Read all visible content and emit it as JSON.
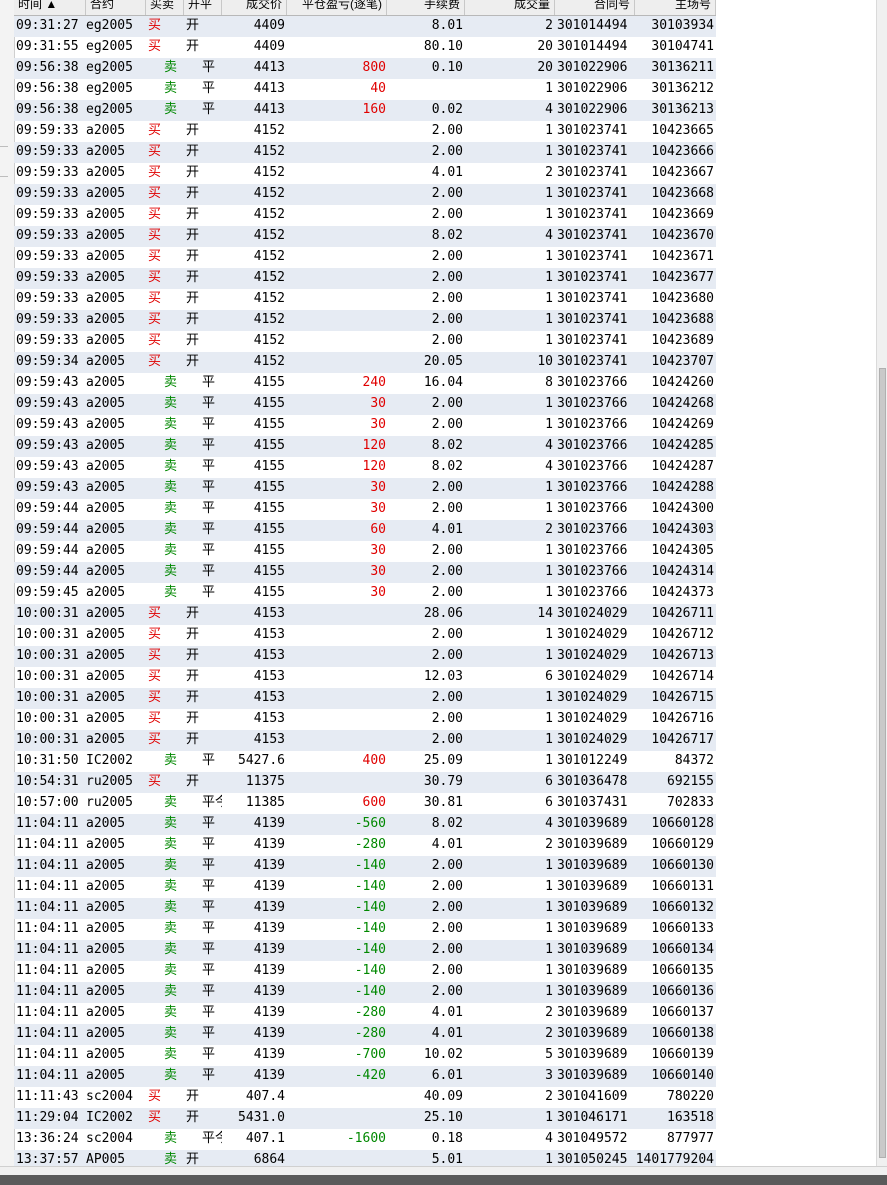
{
  "columns": {
    "time": "时间 ▲",
    "symbol": "合约",
    "direction": "买卖",
    "open_close": "开平",
    "price": "成交价",
    "close_pnl": "平仓盈亏(逐笔)",
    "fee": "手续费",
    "qty": "成交量",
    "order_no": "合同号",
    "trade_no": "主场号"
  },
  "rows": [
    [
      "09:31:27",
      "eg2005",
      "买",
      "开",
      "4409",
      "",
      "8.01",
      "2",
      "301014494",
      "30103934"
    ],
    [
      "09:31:55",
      "eg2005",
      "买",
      "开",
      "4409",
      "",
      "80.10",
      "20",
      "301014494",
      "30104741"
    ],
    [
      "09:56:38",
      "eg2005",
      "卖",
      "平",
      "4413",
      "800",
      "0.10",
      "20",
      "301022906",
      "30136211"
    ],
    [
      "09:56:38",
      "eg2005",
      "卖",
      "平",
      "4413",
      "40",
      "",
      "1",
      "301022906",
      "30136212"
    ],
    [
      "09:56:38",
      "eg2005",
      "卖",
      "平",
      "4413",
      "160",
      "0.02",
      "4",
      "301022906",
      "30136213"
    ],
    [
      "09:59:33",
      "a2005",
      "买",
      "开",
      "4152",
      "",
      "2.00",
      "1",
      "301023741",
      "10423665"
    ],
    [
      "09:59:33",
      "a2005",
      "买",
      "开",
      "4152",
      "",
      "2.00",
      "1",
      "301023741",
      "10423666"
    ],
    [
      "09:59:33",
      "a2005",
      "买",
      "开",
      "4152",
      "",
      "4.01",
      "2",
      "301023741",
      "10423667"
    ],
    [
      "09:59:33",
      "a2005",
      "买",
      "开",
      "4152",
      "",
      "2.00",
      "1",
      "301023741",
      "10423668"
    ],
    [
      "09:59:33",
      "a2005",
      "买",
      "开",
      "4152",
      "",
      "2.00",
      "1",
      "301023741",
      "10423669"
    ],
    [
      "09:59:33",
      "a2005",
      "买",
      "开",
      "4152",
      "",
      "8.02",
      "4",
      "301023741",
      "10423670"
    ],
    [
      "09:59:33",
      "a2005",
      "买",
      "开",
      "4152",
      "",
      "2.00",
      "1",
      "301023741",
      "10423671"
    ],
    [
      "09:59:33",
      "a2005",
      "买",
      "开",
      "4152",
      "",
      "2.00",
      "1",
      "301023741",
      "10423677"
    ],
    [
      "09:59:33",
      "a2005",
      "买",
      "开",
      "4152",
      "",
      "2.00",
      "1",
      "301023741",
      "10423680"
    ],
    [
      "09:59:33",
      "a2005",
      "买",
      "开",
      "4152",
      "",
      "2.00",
      "1",
      "301023741",
      "10423688"
    ],
    [
      "09:59:33",
      "a2005",
      "买",
      "开",
      "4152",
      "",
      "2.00",
      "1",
      "301023741",
      "10423689"
    ],
    [
      "09:59:34",
      "a2005",
      "买",
      "开",
      "4152",
      "",
      "20.05",
      "10",
      "301023741",
      "10423707"
    ],
    [
      "09:59:43",
      "a2005",
      "卖",
      "平",
      "4155",
      "240",
      "16.04",
      "8",
      "301023766",
      "10424260"
    ],
    [
      "09:59:43",
      "a2005",
      "卖",
      "平",
      "4155",
      "30",
      "2.00",
      "1",
      "301023766",
      "10424268"
    ],
    [
      "09:59:43",
      "a2005",
      "卖",
      "平",
      "4155",
      "30",
      "2.00",
      "1",
      "301023766",
      "10424269"
    ],
    [
      "09:59:43",
      "a2005",
      "卖",
      "平",
      "4155",
      "120",
      "8.02",
      "4",
      "301023766",
      "10424285"
    ],
    [
      "09:59:43",
      "a2005",
      "卖",
      "平",
      "4155",
      "120",
      "8.02",
      "4",
      "301023766",
      "10424287"
    ],
    [
      "09:59:43",
      "a2005",
      "卖",
      "平",
      "4155",
      "30",
      "2.00",
      "1",
      "301023766",
      "10424288"
    ],
    [
      "09:59:44",
      "a2005",
      "卖",
      "平",
      "4155",
      "30",
      "2.00",
      "1",
      "301023766",
      "10424300"
    ],
    [
      "09:59:44",
      "a2005",
      "卖",
      "平",
      "4155",
      "60",
      "4.01",
      "2",
      "301023766",
      "10424303"
    ],
    [
      "09:59:44",
      "a2005",
      "卖",
      "平",
      "4155",
      "30",
      "2.00",
      "1",
      "301023766",
      "10424305"
    ],
    [
      "09:59:44",
      "a2005",
      "卖",
      "平",
      "4155",
      "30",
      "2.00",
      "1",
      "301023766",
      "10424314"
    ],
    [
      "09:59:45",
      "a2005",
      "卖",
      "平",
      "4155",
      "30",
      "2.00",
      "1",
      "301023766",
      "10424373"
    ],
    [
      "10:00:31",
      "a2005",
      "买",
      "开",
      "4153",
      "",
      "28.06",
      "14",
      "301024029",
      "10426711"
    ],
    [
      "10:00:31",
      "a2005",
      "买",
      "开",
      "4153",
      "",
      "2.00",
      "1",
      "301024029",
      "10426712"
    ],
    [
      "10:00:31",
      "a2005",
      "买",
      "开",
      "4153",
      "",
      "2.00",
      "1",
      "301024029",
      "10426713"
    ],
    [
      "10:00:31",
      "a2005",
      "买",
      "开",
      "4153",
      "",
      "12.03",
      "6",
      "301024029",
      "10426714"
    ],
    [
      "10:00:31",
      "a2005",
      "买",
      "开",
      "4153",
      "",
      "2.00",
      "1",
      "301024029",
      "10426715"
    ],
    [
      "10:00:31",
      "a2005",
      "买",
      "开",
      "4153",
      "",
      "2.00",
      "1",
      "301024029",
      "10426716"
    ],
    [
      "10:00:31",
      "a2005",
      "买",
      "开",
      "4153",
      "",
      "2.00",
      "1",
      "301024029",
      "10426717"
    ],
    [
      "10:31:50",
      "IC2002",
      "卖",
      "平",
      "5427.6",
      "400",
      "25.09",
      "1",
      "301012249",
      "84372"
    ],
    [
      "10:54:31",
      "ru2005",
      "买",
      "开",
      "11375",
      "",
      "30.79",
      "6",
      "301036478",
      "692155"
    ],
    [
      "10:57:00",
      "ru2005",
      "卖",
      "平今",
      "11385",
      "600",
      "30.81",
      "6",
      "301037431",
      "702833"
    ],
    [
      "11:04:11",
      "a2005",
      "卖",
      "平",
      "4139",
      "-560",
      "8.02",
      "4",
      "301039689",
      "10660128"
    ],
    [
      "11:04:11",
      "a2005",
      "卖",
      "平",
      "4139",
      "-280",
      "4.01",
      "2",
      "301039689",
      "10660129"
    ],
    [
      "11:04:11",
      "a2005",
      "卖",
      "平",
      "4139",
      "-140",
      "2.00",
      "1",
      "301039689",
      "10660130"
    ],
    [
      "11:04:11",
      "a2005",
      "卖",
      "平",
      "4139",
      "-140",
      "2.00",
      "1",
      "301039689",
      "10660131"
    ],
    [
      "11:04:11",
      "a2005",
      "卖",
      "平",
      "4139",
      "-140",
      "2.00",
      "1",
      "301039689",
      "10660132"
    ],
    [
      "11:04:11",
      "a2005",
      "卖",
      "平",
      "4139",
      "-140",
      "2.00",
      "1",
      "301039689",
      "10660133"
    ],
    [
      "11:04:11",
      "a2005",
      "卖",
      "平",
      "4139",
      "-140",
      "2.00",
      "1",
      "301039689",
      "10660134"
    ],
    [
      "11:04:11",
      "a2005",
      "卖",
      "平",
      "4139",
      "-140",
      "2.00",
      "1",
      "301039689",
      "10660135"
    ],
    [
      "11:04:11",
      "a2005",
      "卖",
      "平",
      "4139",
      "-140",
      "2.00",
      "1",
      "301039689",
      "10660136"
    ],
    [
      "11:04:11",
      "a2005",
      "卖",
      "平",
      "4139",
      "-280",
      "4.01",
      "2",
      "301039689",
      "10660137"
    ],
    [
      "11:04:11",
      "a2005",
      "卖",
      "平",
      "4139",
      "-280",
      "4.01",
      "2",
      "301039689",
      "10660138"
    ],
    [
      "11:04:11",
      "a2005",
      "卖",
      "平",
      "4139",
      "-700",
      "10.02",
      "5",
      "301039689",
      "10660139"
    ],
    [
      "11:04:11",
      "a2005",
      "卖",
      "平",
      "4139",
      "-420",
      "6.01",
      "3",
      "301039689",
      "10660140"
    ],
    [
      "11:11:43",
      "sc2004",
      "买",
      "开",
      "407.4",
      "",
      "40.09",
      "2",
      "301041609",
      "780220"
    ],
    [
      "11:29:04",
      "IC2002",
      "买",
      "开",
      "5431.0",
      "",
      "25.10",
      "1",
      "301046171",
      "163518"
    ],
    [
      "13:36:24",
      "sc2004",
      "卖",
      "平今",
      "407.1",
      "-1600",
      "0.18",
      "4",
      "301049572",
      "877977"
    ],
    [
      "13:37:57",
      "AP005",
      "卖",
      "开",
      "6864",
      "",
      "5.01",
      "1",
      "301050245",
      "1401779204"
    ]
  ],
  "colors": {
    "buy": "#e00000",
    "sell": "#008800",
    "row_alt": "#e6ebf3",
    "header_bg": "#eeeeee"
  }
}
